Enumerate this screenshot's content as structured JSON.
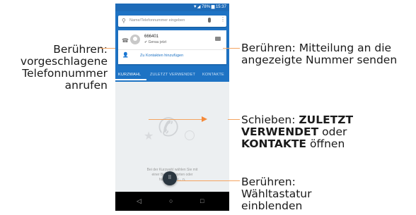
{
  "status_bar": {
    "text": "▼◢ 78% ▆ 15:37"
  },
  "search": {
    "placeholder": "Name/Telefonnummer eingeben"
  },
  "recent_call": {
    "number": "666401",
    "time": "✔ Genau jetzt"
  },
  "add_contact_label": "Zu Kontakten hinzufügen",
  "tabs": [
    "KURZWAHL",
    "ZULETZT VERWENDET",
    "KONTAKTE"
  ],
  "empty_text_lines": [
    "Bei der Kurzwahl wählen Sie mit",
    "einer Berühr... vorten oder",
    "häufig anger... n."
  ],
  "navbar": {
    "back": "◁",
    "home": "○",
    "recents": "□"
  },
  "callouts": {
    "left_lines": [
      "Berühren:",
      "vorgeschlagene",
      "Telefonnummer",
      "anrufen"
    ],
    "right1_lines": [
      "Berühren: Mitteilung an die",
      "angezeigte Nummer senden"
    ],
    "right2": {
      "prefix": "Schieben: ",
      "b1": "ZULETZT",
      "b2": "VERWENDET",
      "middle": " oder",
      "b3": "KONTAKTE",
      "suffix": " öffnen"
    },
    "right3_lines": [
      "Berühren:",
      "Wähltastatur",
      "einblenden"
    ]
  },
  "colors": {
    "accent": "#1e73c4",
    "connector": "#f4a460"
  }
}
